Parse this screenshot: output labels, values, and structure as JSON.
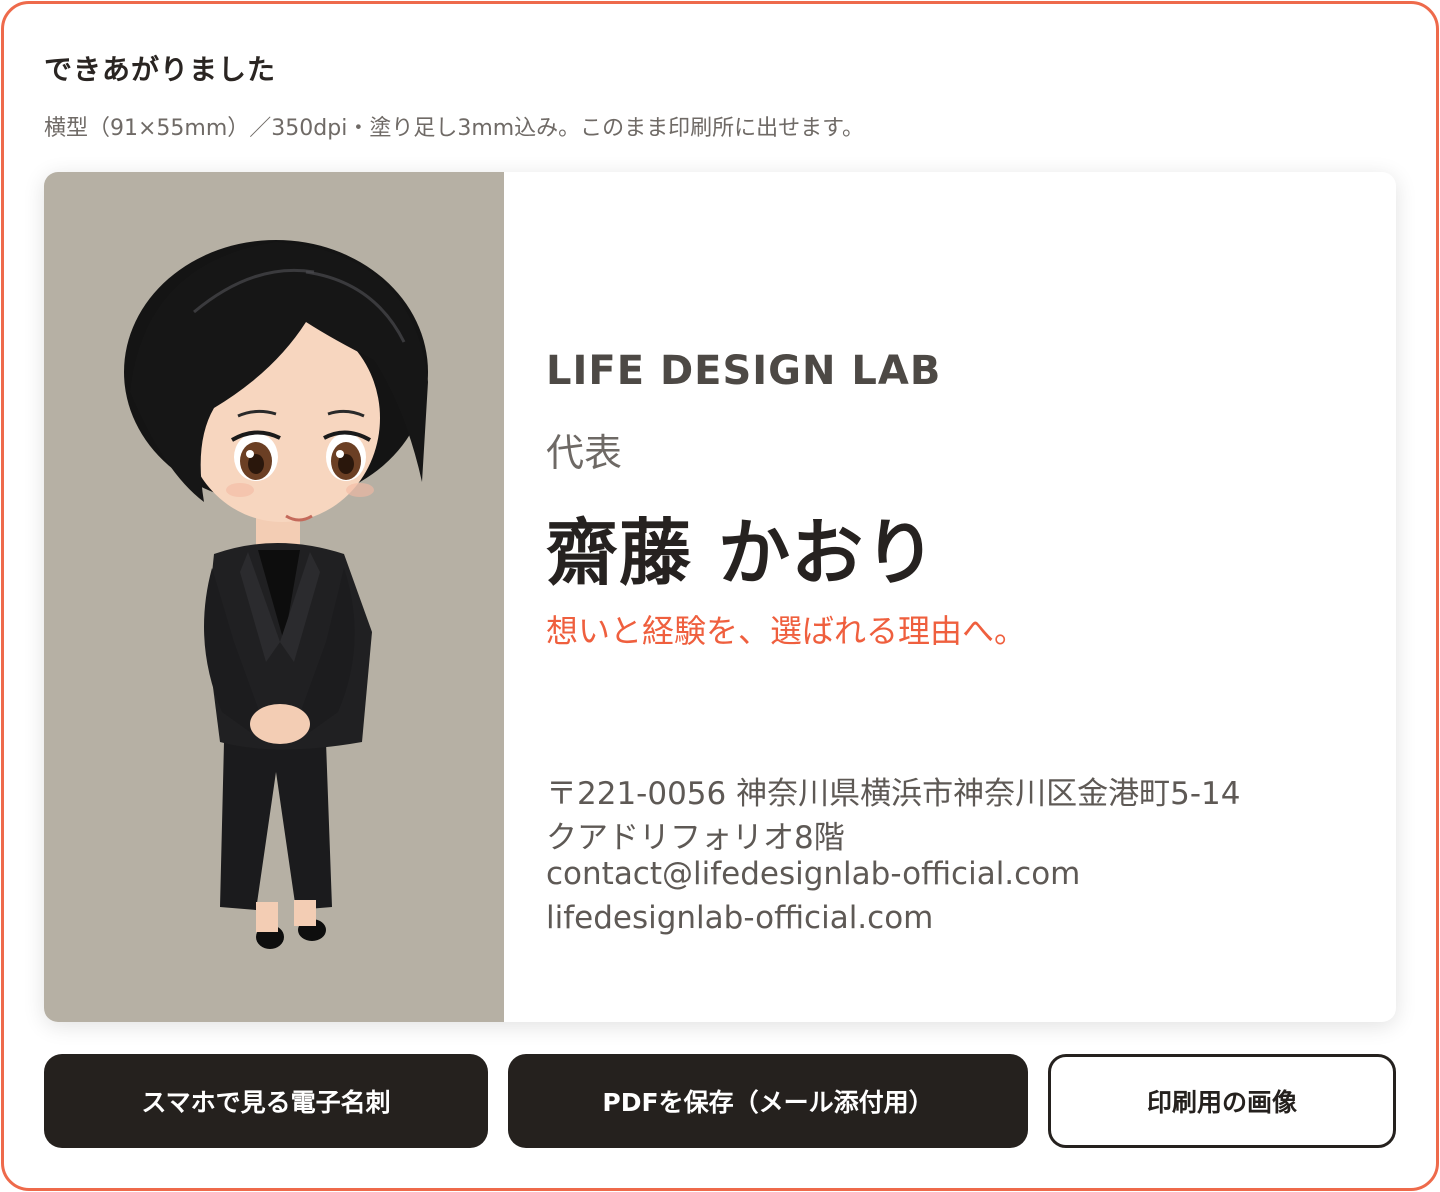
{
  "header": {
    "title": "できあがりました",
    "subtitle": "横型（91×55mm）／350dpi・塗り足し3mm込み。このまま印刷所に出せます。"
  },
  "card": {
    "company": "LIFE DESIGN LAB",
    "role": "代表",
    "name": "齋藤 かおり",
    "tagline": "想いと経験を、選ばれる理由へ。",
    "address_line1": "〒221-0056 神奈川県横浜市神奈川区金港町5-14",
    "address_line2": "クアドリフォリオ8階",
    "email": "contact@lifedesignlab-official.com",
    "website": "lifedesignlab-official.com",
    "portrait": "illustrated-portrait"
  },
  "actions": {
    "mobile_label": "スマホで見る電子名刺",
    "pdf_label": "PDFを保存（メール添付用）",
    "print_label": "印刷用の画像"
  },
  "colors": {
    "frame_border": "#ee6a4b",
    "accent": "#ef5f3e",
    "button_dark": "#25211e",
    "portrait_bg": "#b6b0a4"
  }
}
